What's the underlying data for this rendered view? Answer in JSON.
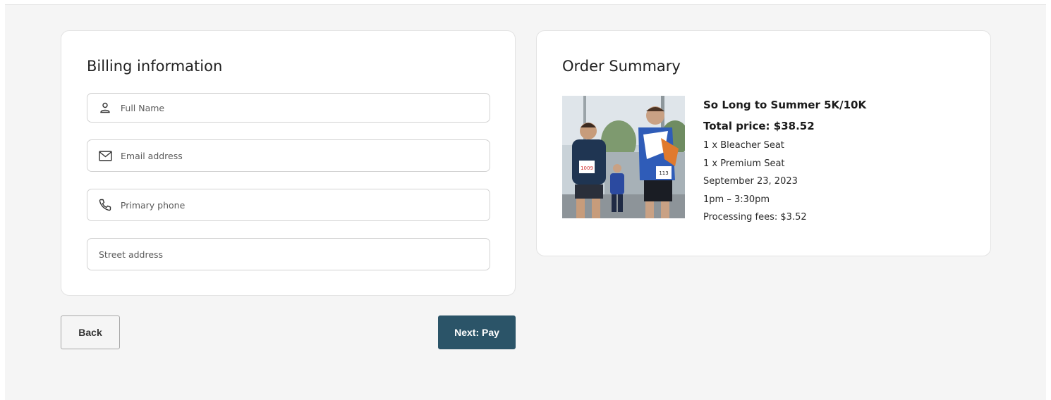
{
  "billing": {
    "title": "Billing information",
    "full_name_placeholder": "Full Name",
    "email_placeholder": "Email address",
    "phone_placeholder": "Primary phone",
    "street_placeholder": "Street address"
  },
  "summary": {
    "title": "Order Summary",
    "event_name": "So Long to Summer 5K/10K",
    "total_price": "Total price: $38.52",
    "lines": [
      "1 x Bleacher Seat",
      "1 x Premium Seat",
      "September 23, 2023",
      "1pm – 3:30pm",
      "Processing fees: $3.52"
    ],
    "runner_bibs": [
      "1009",
      "113"
    ]
  },
  "actions": {
    "back_label": "Back",
    "next_label": "Next: Pay"
  },
  "colors": {
    "page_background": "#f5f5f5",
    "primary_button": "#2b5468"
  },
  "icons": [
    "user-icon",
    "mail-icon",
    "phone-icon"
  ]
}
